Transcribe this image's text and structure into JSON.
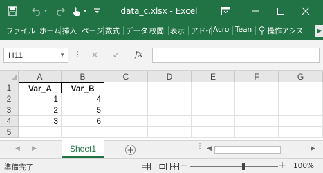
{
  "window": {
    "title": "data_c.xlsx - Excel",
    "minimize_icon": "minimize-icon",
    "restore_icon": "restore-icon",
    "close_icon": "close-icon"
  },
  "quick_access": {
    "icons": [
      "save-icon",
      "undo-icon",
      "redo-icon",
      "touch-mode-icon",
      "customize-icon"
    ]
  },
  "ribbon": {
    "tabs": [
      "ファイル",
      "ホーム",
      "挿入",
      "ページ",
      "数式",
      "データ",
      "校閲",
      "表示",
      "アドイ",
      "Acro",
      "Tean"
    ],
    "tell_me": "操作アシス",
    "tell_me_icon": "lightbulb-icon"
  },
  "formula_bar": {
    "name_box": "H11",
    "cancel_glyph": "✕",
    "enter_glyph": "✓",
    "fx_label": "fx",
    "formula": ""
  },
  "grid": {
    "columns": [
      "A",
      "B",
      "C",
      "D",
      "E",
      "F",
      "G"
    ],
    "rows": [
      "1",
      "2",
      "3",
      "4",
      "5"
    ],
    "cells": {
      "A1": "Var_A",
      "B1": "Var_B",
      "A2": "1",
      "B2": "4",
      "A3": "2",
      "B3": "5",
      "A4": "3",
      "B4": "6"
    }
  },
  "sheets": {
    "tabs": [
      "Sheet1"
    ],
    "active": "Sheet1",
    "add_label": "+",
    "colors": {
      "accent": "#217346"
    }
  },
  "status": {
    "text": "準備完了",
    "zoom": "100%",
    "zoom_minus": "−",
    "zoom_plus": "+"
  }
}
